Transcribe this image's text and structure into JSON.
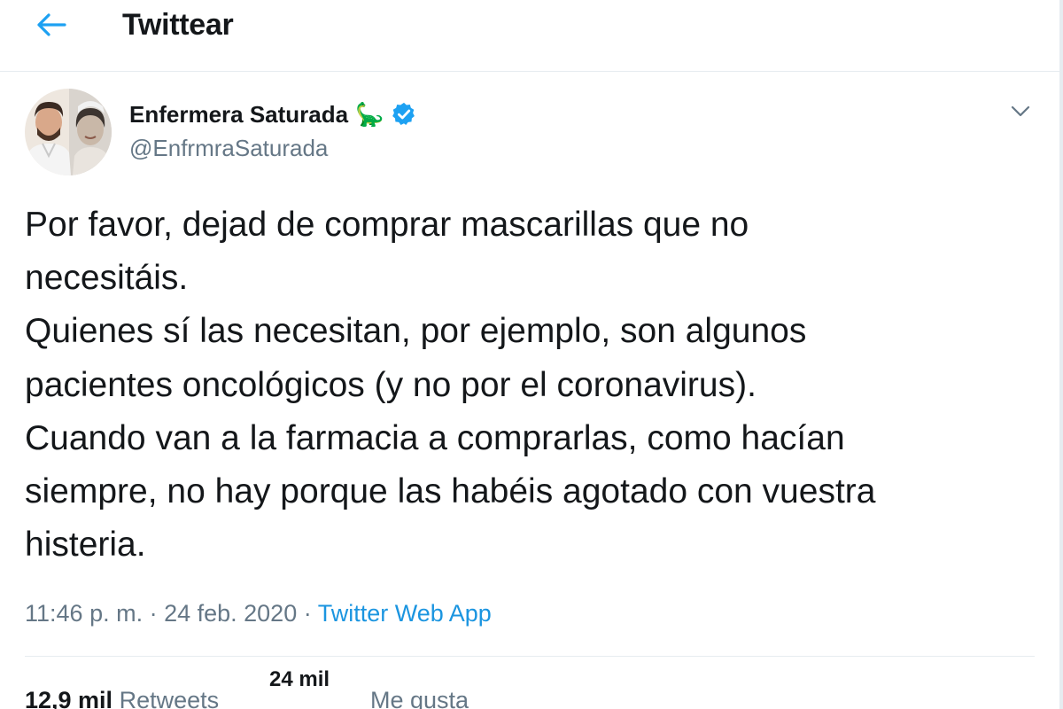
{
  "header": {
    "title": "Twittear",
    "back_icon": "back-arrow-icon",
    "accent_color": "#1da1f2"
  },
  "author": {
    "name": "Enfermera Saturada",
    "emoji": "🦕",
    "verified_icon": "verified-badge-icon",
    "handle": "@EnfrmraSaturada",
    "avatar_icon": "profile-avatar"
  },
  "tweet": {
    "lines": [
      "Por favor, dejad de comprar mascarillas que no",
      "necesitáis.",
      "Quienes sí las necesitan, por ejemplo, son algunos",
      "pacientes oncológicos (y no por el coronavirus).",
      "Cuando van a la farmacia a comprarlas, como hacían",
      "siempre, no hay porque las habéis agotado con vuestra",
      "histeria."
    ]
  },
  "meta": {
    "time": "11:46 p. m.",
    "sep1": " · ",
    "date": "24 feb. 2020",
    "sep2": " · ",
    "source": "Twitter Web App",
    "source_color": "#1b95e0"
  },
  "stats": {
    "retweets_count": "12,9 mil",
    "retweets_label": "Retweets",
    "likes_count": "24 mil",
    "likes_label": "Me gusta"
  },
  "colors": {
    "text_primary": "#14171a",
    "text_secondary": "#657786",
    "divider": "#e6ecf0"
  }
}
